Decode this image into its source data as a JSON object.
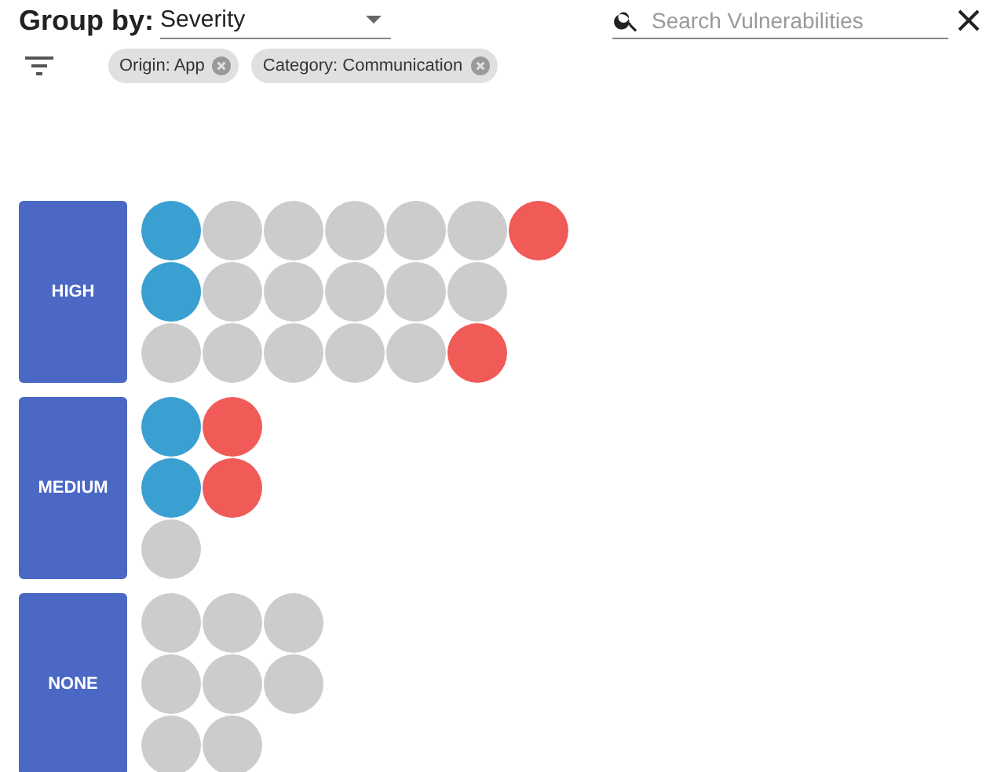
{
  "group_by": {
    "label": "Group by:",
    "value": "Severity"
  },
  "search": {
    "placeholder": "Search Vulnerabilities"
  },
  "chips": [
    {
      "label": "Origin: App"
    },
    {
      "label": "Category: Communication"
    }
  ],
  "groups": [
    {
      "label": "HIGH",
      "rows": [
        [
          {
            "color": "#3a9fd1"
          },
          {
            "color": "#cccccc"
          },
          {
            "color": "#cccccc"
          },
          {
            "color": "#cccccc"
          },
          {
            "color": "#cccccc"
          },
          {
            "color": "#cccccc"
          },
          {
            "color": "#f05a57"
          }
        ],
        [
          {
            "color": "#3a9fd1"
          },
          {
            "color": "#cccccc"
          },
          {
            "color": "#cccccc"
          },
          {
            "color": "#cccccc"
          },
          {
            "color": "#cccccc"
          },
          {
            "color": "#cccccc"
          }
        ],
        [
          {
            "color": "#cccccc"
          },
          {
            "color": "#cccccc"
          },
          {
            "color": "#cccccc"
          },
          {
            "color": "#cccccc"
          },
          {
            "color": "#cccccc"
          },
          {
            "color": "#f05a57"
          }
        ]
      ]
    },
    {
      "label": "MEDIUM",
      "rows": [
        [
          {
            "color": "#3a9fd1"
          },
          {
            "color": "#f05a57"
          }
        ],
        [
          {
            "color": "#3a9fd1"
          },
          {
            "color": "#f05a57"
          }
        ],
        [
          {
            "color": "#cccccc"
          }
        ]
      ]
    },
    {
      "label": "NONE",
      "rows": [
        [
          {
            "color": "#cccccc"
          },
          {
            "color": "#cccccc"
          },
          {
            "color": "#cccccc"
          }
        ],
        [
          {
            "color": "#cccccc"
          },
          {
            "color": "#cccccc"
          },
          {
            "color": "#cccccc"
          }
        ],
        [
          {
            "color": "#cccccc"
          },
          {
            "color": "#cccccc"
          }
        ]
      ]
    }
  ]
}
